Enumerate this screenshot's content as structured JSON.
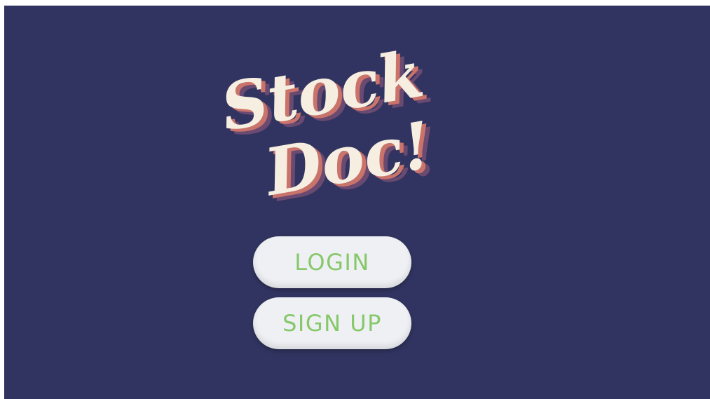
{
  "logo": {
    "line1": "Stock",
    "line2": "Doc!",
    "text_color": "#f6eee0",
    "shadow_color_1": "#c9736a",
    "shadow_color_2": "#6a4a70"
  },
  "buttons": {
    "login_label": "LOGIN",
    "signup_label": "SIGN UP",
    "label_color": "#86c86a",
    "background_color": "#eef0f4"
  },
  "background_color": "#313460"
}
